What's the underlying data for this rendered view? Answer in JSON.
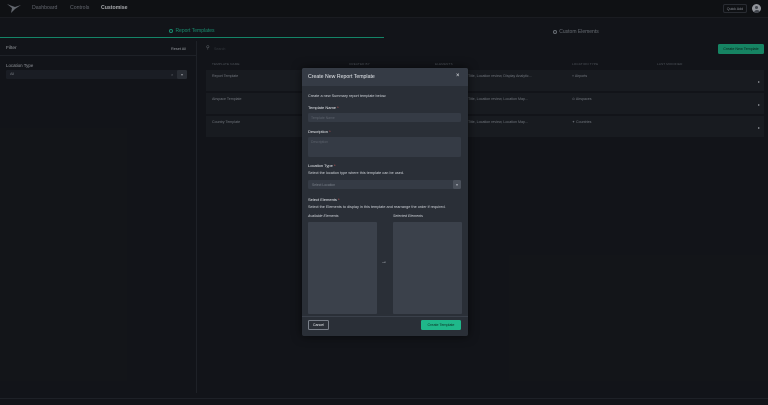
{
  "nav": {
    "links": [
      "Dashboard",
      "Controls",
      "Customise"
    ],
    "quick_button": "Quick Add"
  },
  "tabs": [
    {
      "label": "Report Templates",
      "icon": "template-icon",
      "active": true
    },
    {
      "label": "Custom Elements",
      "icon": "elements-icon",
      "active": false
    }
  ],
  "sidebar": {
    "title": "Filter",
    "reset_label": "Reset All",
    "location_type_label": "Location Type",
    "location_type_value": "All"
  },
  "main": {
    "search_placeholder": "Search",
    "create_button": "Create New Template",
    "columns": [
      "TEMPLATE NAME",
      "CREATED BY",
      "ELEMENTS",
      "LOCATION TYPE",
      "LAST MODIFIED"
    ],
    "rows": [
      {
        "name": "Report Template",
        "elements": "Title, Location review, Display Analytic...",
        "location_type": "Airports"
      },
      {
        "name": "Airspace Template",
        "elements": "Title, Location review, Location Map...",
        "location_type": "Airspaces"
      },
      {
        "name": "Country Template",
        "elements": "Title, Location review, Location Map...",
        "location_type": "Countries"
      }
    ]
  },
  "modal": {
    "title": "Create New Report Template",
    "intro": "Create a new Summary report template below.",
    "template_name_label": "Template Name",
    "template_name_placeholder": "Template Name",
    "description_label": "Description",
    "description_placeholder": "Description",
    "location_type_label": "Location Type",
    "location_type_help": "Select the location type where this template can be used.",
    "location_select_placeholder": "Select Location",
    "elements_label": "Select Elements",
    "elements_help": "Select the Elements to display in this template and rearrange the order if required.",
    "available_title": "Available Elements",
    "selected_title": "Selected Elements",
    "required_mark": "*",
    "cancel_label": "Cancel",
    "submit_label": "Create Template"
  },
  "colors": {
    "accent": "#1fb88a",
    "background": "#1a1d23",
    "modal": "#2a2f37"
  }
}
